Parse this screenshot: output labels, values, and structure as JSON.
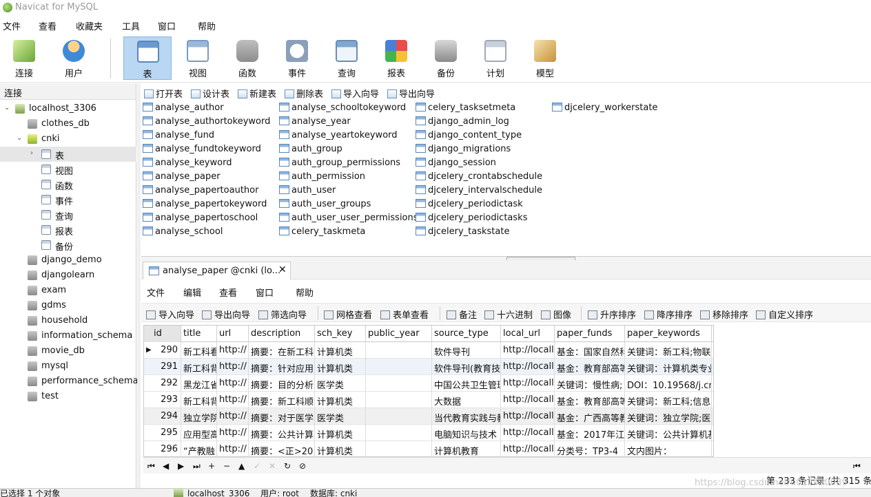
{
  "window": {
    "title": "Navicat for MySQL"
  },
  "menu": [
    "文件",
    "查看",
    "收藏夹",
    "工具",
    "窗口",
    "帮助"
  ],
  "toolbar": [
    {
      "label": "连接",
      "icon": "connect-icon",
      "color": "#8bc34a"
    },
    {
      "label": "用户",
      "icon": "user-icon",
      "color": "#f0a030"
    },
    {
      "label": "表",
      "icon": "table-icon",
      "color": "#6a9ad0"
    },
    {
      "label": "视图",
      "icon": "view-icon",
      "color": "#7a9bc4"
    },
    {
      "label": "函数",
      "icon": "function-icon",
      "color": "#e6a23c"
    },
    {
      "label": "事件",
      "icon": "event-icon",
      "color": "#8aa0b8"
    },
    {
      "label": "查询",
      "icon": "query-icon",
      "color": "#7fa7cf"
    },
    {
      "label": "报表",
      "icon": "report-icon",
      "color": "#d86ad0"
    },
    {
      "label": "备份",
      "icon": "backup-icon",
      "color": "#9a9a9a"
    },
    {
      "label": "计划",
      "icon": "schedule-icon",
      "color": "#a0a8b8"
    },
    {
      "label": "模型",
      "icon": "model-icon",
      "color": "#d9a84a"
    }
  ],
  "sidebar": {
    "header": "连接",
    "items": [
      {
        "label": "localhost_3306",
        "type": "server",
        "arrow": "expanded"
      },
      {
        "label": "clothes_db",
        "type": "db"
      },
      {
        "label": "cnki",
        "type": "db-open",
        "arrow": "expanded"
      },
      {
        "label": "表",
        "type": "tables",
        "arrow": "collapsed"
      },
      {
        "label": "视图",
        "type": "view"
      },
      {
        "label": "函数",
        "type": "function"
      },
      {
        "label": "事件",
        "type": "event"
      },
      {
        "label": "查询",
        "type": "query"
      },
      {
        "label": "报表",
        "type": "report"
      },
      {
        "label": "备份",
        "type": "backup"
      },
      {
        "label": "django_demo",
        "type": "db"
      },
      {
        "label": "djangolearn",
        "type": "db"
      },
      {
        "label": "exam",
        "type": "db"
      },
      {
        "label": "gdms",
        "type": "db"
      },
      {
        "label": "household",
        "type": "db"
      },
      {
        "label": "information_schema",
        "type": "db"
      },
      {
        "label": "movie_db",
        "type": "db"
      },
      {
        "label": "mysql",
        "type": "db"
      },
      {
        "label": "performance_schema",
        "type": "db"
      },
      {
        "label": "test",
        "type": "db"
      }
    ]
  },
  "object_toolbar": [
    "打开表",
    "设计表",
    "新建表",
    "删除表",
    "导入向导",
    "导出向导"
  ],
  "tables": [
    [
      "analyse_author",
      "analyse_authortokeyword",
      "analyse_fund",
      "analyse_fundtokeyword",
      "analyse_keyword",
      "analyse_paper",
      "analyse_papertoauthor",
      "analyse_papertokeyword",
      "analyse_papertoschool",
      "analyse_school"
    ],
    [
      "analyse_schooltokeyword",
      "analyse_year",
      "analyse_yeartokeyword",
      "auth_group",
      "auth_group_permissions",
      "auth_permission",
      "auth_user",
      "auth_user_groups",
      "auth_user_user_permissions",
      "celery_taskmeta"
    ],
    [
      "celery_tasksetmeta",
      "django_admin_log",
      "django_content_type",
      "django_migrations",
      "django_session",
      "djcelery_crontabschedule",
      "djcelery_intervalschedule",
      "djcelery_periodictask",
      "djcelery_periodictasks",
      "djcelery_taskstate"
    ],
    [
      "djcelery_workerstate"
    ]
  ],
  "tab": {
    "label": "analyse_paper @cnki (lo...",
    "close": "✕"
  },
  "inner_menu": [
    "文件",
    "编辑",
    "查看",
    "窗口",
    "帮助"
  ],
  "inner_toolbar": [
    "导入向导",
    "导出向导",
    "筛选向导",
    "网格查看",
    "表单查看",
    "备注",
    "十六进制",
    "图像",
    "升序排序",
    "降序排序",
    "移除排序",
    "自定义排序"
  ],
  "grid": {
    "columns": [
      "id",
      "title",
      "url",
      "description",
      "sch_key",
      "public_year",
      "source_type",
      "local_url",
      "paper_funds",
      "paper_keywords"
    ],
    "rows": [
      [
        "290",
        "新工科看",
        "http://",
        "摘要：在新工科",
        "计算机类",
        "",
        "软件导刊",
        "http://locall",
        "基金：国家自然科",
        "关键词：新工科;物联"
      ],
      [
        "291",
        "新工科背",
        "http://",
        "摘要：针对应用",
        "计算机类",
        "",
        "软件导刊(教育技",
        "http://locall",
        "基金：教育部高等",
        "关键词：计算机类专业"
      ],
      [
        "292",
        "黑龙江省",
        "http://",
        "摘要：目的分析",
        "医学类",
        "",
        "中国公共卫生管理",
        "http://locall",
        "关键词：慢性病;",
        "DOI：10.19568/j.cn"
      ],
      [
        "293",
        "新工科背",
        "http://",
        "摘要：新工科顺",
        "计算机类",
        "",
        "大数据",
        "http://locall",
        "基金：教育部高等",
        "关键词：新工科;信息"
      ],
      [
        "294",
        "独立学院",
        "http://",
        "摘要：对于医学",
        "医学类",
        "",
        "当代教育实践与教",
        "http://locall",
        "基金：广西高等教",
        "关键词：独立学院;医"
      ],
      [
        "295",
        "应用型高",
        "http://",
        "摘要：公共计算",
        "计算机类",
        "",
        "电脑知识与技术",
        "http://locall",
        "基金：2017年江",
        "关键词：公共计算机基"
      ],
      [
        "296",
        "“产教融",
        "http://",
        "摘要：<正>20",
        "计算机类",
        "",
        "计算机教育",
        "http://locall",
        "分类号：TP3-4",
        "文内图片："
      ]
    ]
  },
  "nav_buttons": [
    "⏮",
    "◀",
    "▶",
    "⏭",
    "+",
    "−",
    "▲",
    "✓",
    "✕",
    "↻",
    "⊘"
  ],
  "record_info": "第 233 条记录 (共 315 条",
  "status": {
    "left": "已选择 1 个对象",
    "conn": "localhost_3306",
    "user": "用户: root",
    "db": "数据库: cnki"
  },
  "watermark": "https://blog.csdn.net/u012590039"
}
